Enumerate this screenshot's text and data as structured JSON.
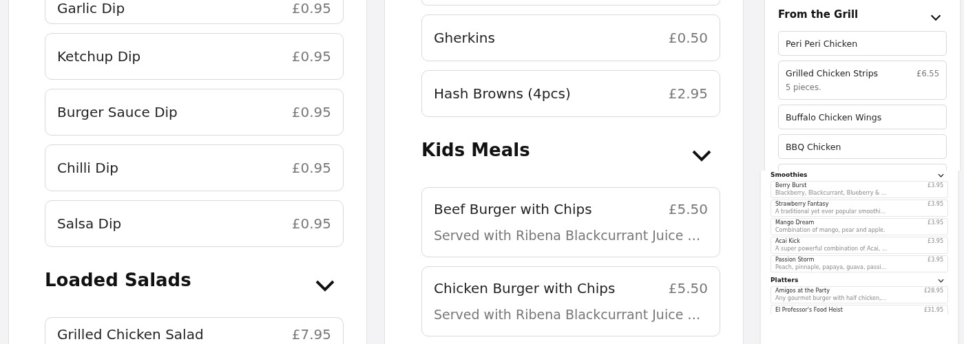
{
  "panels": [
    {
      "kind": "large",
      "blocks": [
        {
          "kind": "item",
          "name": "Garlic Dip",
          "price": "£0.95"
        },
        {
          "kind": "item",
          "name": "Ketchup Dip",
          "price": "£0.95"
        },
        {
          "kind": "item",
          "name": "Burger Sauce Dip",
          "price": "£0.95"
        },
        {
          "kind": "item",
          "name": "Chilli Dip",
          "price": "£0.95"
        },
        {
          "kind": "item",
          "name": "Salsa Dip",
          "price": "£0.95"
        },
        {
          "kind": "heading",
          "title": "Loaded Salads"
        },
        {
          "kind": "item",
          "name": "Grilled Chicken Salad",
          "price": "£7.95"
        }
      ]
    },
    {
      "kind": "large",
      "blocks": [
        {
          "kind": "card_edge"
        },
        {
          "kind": "item",
          "name": "Gherkins",
          "price": "£0.50"
        },
        {
          "kind": "item",
          "name": "Hash Browns (4pcs)",
          "price": "£2.95"
        },
        {
          "kind": "heading",
          "title": "Kids Meals"
        },
        {
          "kind": "item",
          "name": "Beef Burger with Chips",
          "price": "£5.50",
          "description": "Served with Ribena Blackcurrant Juice …"
        },
        {
          "kind": "item",
          "name": "Chicken Burger with Chips",
          "price": "£5.50",
          "description": "Served with Ribena Blackcurrant Juice …"
        }
      ]
    },
    {
      "kind": "small",
      "blocks": [
        {
          "kind": "heading",
          "title": "From the Grill"
        },
        {
          "kind": "item",
          "name": "Peri Peri Chicken"
        },
        {
          "kind": "item",
          "name": "Grilled Chicken Strips",
          "price": "£6.55",
          "description": "5 pieces."
        },
        {
          "kind": "item",
          "name": "Buffalo Chicken Wings"
        },
        {
          "kind": "item",
          "name": "BBQ Chicken"
        },
        {
          "kind": "card_edge"
        }
      ]
    },
    {
      "kind": "tiny",
      "blocks": [
        {
          "kind": "heading",
          "title": "Smoothies"
        },
        {
          "kind": "item",
          "name": "Berry Burst",
          "price": "£3.95",
          "description": "Blackberry, Blackcurrant, Blueberry & ..."
        },
        {
          "kind": "item",
          "name": "Strawberry Fantasy",
          "price": "£3.95",
          "description": "A traditional yet ever popular smoothi..."
        },
        {
          "kind": "item",
          "name": "Mango Dream",
          "price": "£3.95",
          "description": "Combination of mango, pear and apple."
        },
        {
          "kind": "item",
          "name": "Acai Kick",
          "price": "£3.95",
          "description": "A super powerful combination of Acai, ..."
        },
        {
          "kind": "item",
          "name": "Passion Storm",
          "price": "£3.95",
          "description": "Peach, pinnaple, papaya, guava, passi..."
        },
        {
          "kind": "heading",
          "title": "Platters"
        },
        {
          "kind": "item",
          "name": "Amigos at the Party",
          "price": "£28.95",
          "description": "Any gourmet burger with half chicken,..."
        },
        {
          "kind": "item",
          "name": "El Professor's Food Heist",
          "price": "£31.95"
        }
      ]
    }
  ]
}
